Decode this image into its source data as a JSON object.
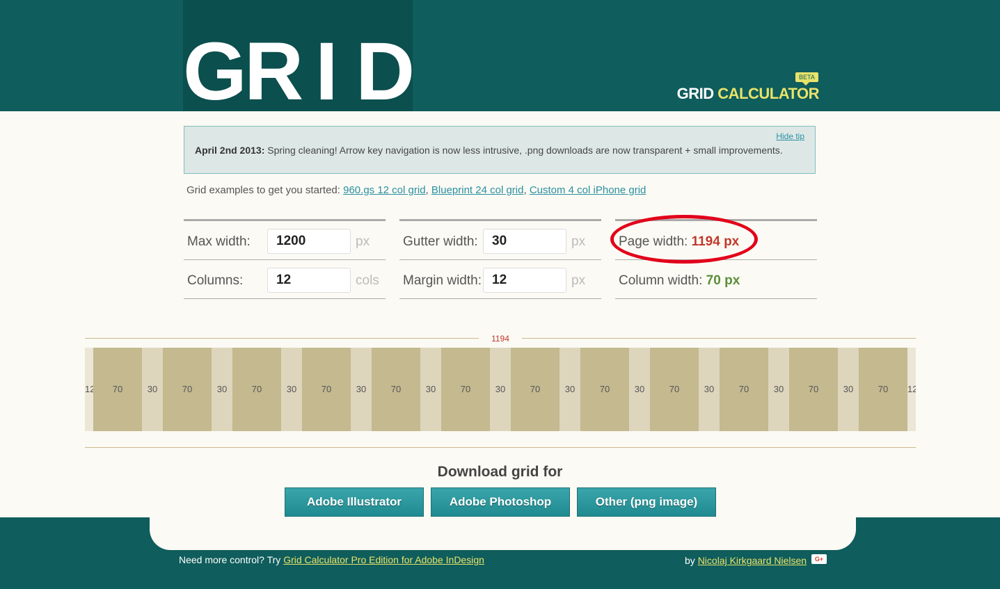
{
  "header": {
    "logo_letters": [
      "G",
      "R",
      "I",
      "D"
    ],
    "calc_word1": "GRID",
    "calc_word2": "CALCULATOR",
    "beta": "BETA"
  },
  "tip": {
    "date": "April 2nd 2013:",
    "message": "Spring cleaning! Arrow key navigation is now less intrusive, .png downloads are now transparent + small improvements.",
    "hide": "Hide tip"
  },
  "examples": {
    "intro": "Grid examples to get you started:",
    "links": [
      "960.gs 12 col grid",
      "Blueprint 24 col grid",
      "Custom 4 col iPhone grid"
    ]
  },
  "settings": {
    "max_width": {
      "label": "Max width:",
      "value": "1200",
      "unit": "px"
    },
    "columns": {
      "label": "Columns:",
      "value": "12",
      "unit": "cols"
    },
    "gutter_width": {
      "label": "Gutter width:",
      "value": "30",
      "unit": "px"
    },
    "margin_width": {
      "label": "Margin width:",
      "value": "12",
      "unit": "px"
    },
    "page_width": {
      "label": "Page width:",
      "value": "1194 px"
    },
    "column_width": {
      "label": "Column width:",
      "value": "70 px"
    }
  },
  "preview": {
    "total_label": "1194",
    "page_width": 1194,
    "margin": 12,
    "column": 70,
    "gutter": 30,
    "columns": 12,
    "margin_label": "12",
    "column_label": "70",
    "gutter_label": "30"
  },
  "download": {
    "title": "Download grid for",
    "buttons": [
      "Adobe Illustrator",
      "Adobe Photoshop",
      "Other (png image)"
    ]
  },
  "footer": {
    "left_text": "Need more control? Try",
    "left_link": "Grid Calculator Pro Edition for Adobe InDesign",
    "right_text": "by",
    "right_link": "Nicolaj Kirkgaard Nielsen",
    "gplus": "G+"
  },
  "colors": {
    "header_bg": "#0f5d5c",
    "accent_yellow": "#e8e36a",
    "page_width_value": "#c0392b",
    "column_width_value": "#5a8e3a",
    "column_fill": "#c4b98f",
    "gutter_fill": "#ded5bd",
    "button_teal": "#2a999e",
    "highlight_circle": "#e2001a"
  }
}
